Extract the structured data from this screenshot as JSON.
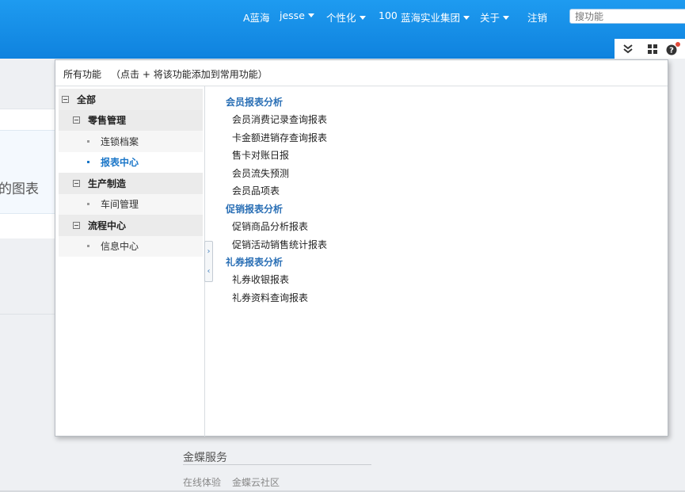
{
  "header": {
    "brand": "A蓝海",
    "user": "jesse",
    "personalize": "个性化",
    "org_code": "100",
    "org_name": "蓝海实业集团",
    "about": "关于",
    "logout": "注销",
    "search_placeholder": "搜功能"
  },
  "toolbar": {
    "collapse_icon": "double-chevron-down-icon",
    "apps_icon": "grid-icon",
    "help_icon": "help-icon"
  },
  "background": {
    "chart_fragment": "的图表",
    "footer_title": "金蝶服务",
    "footer_links": [
      "在线体验",
      "金蝶云社区"
    ]
  },
  "modal": {
    "title": "所有功能",
    "hint": "（点击 + 将该功能添加到常用功能）",
    "tree": [
      {
        "label": "全部",
        "level": 0
      },
      {
        "label": "零售管理",
        "level": 1
      },
      {
        "label": "连锁档案",
        "level": 2
      },
      {
        "label": "报表中心",
        "level": 2,
        "active": true
      },
      {
        "label": "生产制造",
        "level": 1
      },
      {
        "label": "车间管理",
        "level": 2
      },
      {
        "label": "流程中心",
        "level": 1
      },
      {
        "label": "信息中心",
        "level": 2
      }
    ],
    "groups": [
      {
        "title": "会员报表分析",
        "items": [
          "会员消费记录查询报表",
          "卡金额进销存查询报表",
          "售卡对账日报",
          "会员流失预测",
          "会员品项表"
        ]
      },
      {
        "title": "促销报表分析",
        "items": [
          "促销商品分析报表",
          "促销活动销售统计报表"
        ]
      },
      {
        "title": "礼券报表分析",
        "items": [
          "礼券收银报表",
          "礼券资料查询报表"
        ]
      }
    ]
  }
}
